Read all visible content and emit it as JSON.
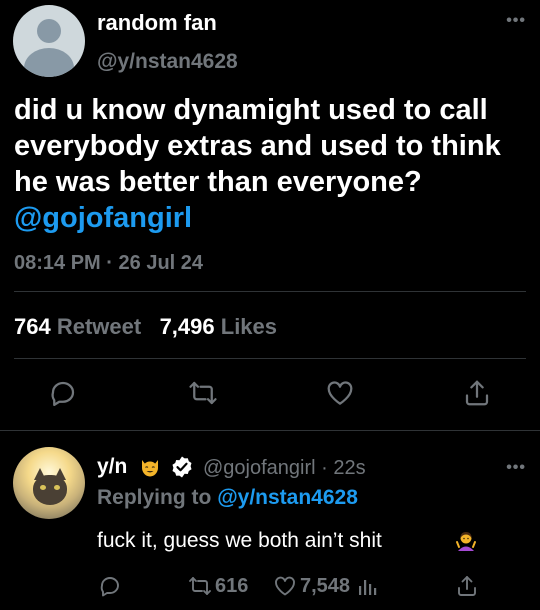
{
  "main_tweet": {
    "display_name": "random fan",
    "handle": "@y/nstan4628",
    "text": "did u know dynamight used to call everybody extras and used to think he was better than everyone?",
    "mention": "@gojofangirl",
    "time": "08:14 PM",
    "date": "26 Jul 24",
    "date_separator": "·",
    "retweets_count": "764",
    "retweets_label": "Retweet",
    "likes_count": "7,496",
    "likes_label": "Likes",
    "more_icon": "more-horizontal-icon"
  },
  "reply": {
    "display_name": "y/n",
    "name_emoji": "smiling-cat-emoji",
    "verified": true,
    "handle": "@gojofangirl",
    "separator": "·",
    "age": "22s",
    "replying_label": "Replying to",
    "replying_handle": "@y/nstan4628",
    "text": "fuck it, guess we both ain’t shit",
    "text_emoji": "person-shrugging-emoji",
    "retweet_count": "616",
    "like_count": "7,548"
  },
  "colors": {
    "background": "#000000",
    "text_primary": "#ffffff",
    "text_secondary": "#71767b",
    "link": "#1d9bf0",
    "divider": "#2f3336"
  }
}
